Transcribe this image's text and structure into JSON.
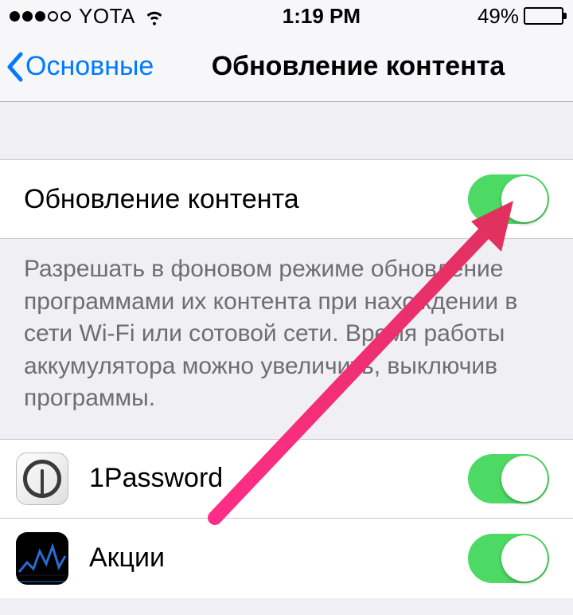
{
  "status_bar": {
    "carrier": "YOTA",
    "time": "1:19 PM",
    "battery_pct": "49%"
  },
  "nav": {
    "back_label": "Основные",
    "title": "Обновление контента"
  },
  "master_toggle": {
    "label": "Обновление контента",
    "on": true
  },
  "footer": "Разрешать в фоновом режиме обновление программами их контента при нахождении в сети Wi-Fi или сотовой сети. Время работы аккумулятора можно увеличить, выключив программы.",
  "apps": [
    {
      "name": "1Password",
      "icon": "1password",
      "on": true
    },
    {
      "name": "Акции",
      "icon": "stocks",
      "on": true
    }
  ]
}
